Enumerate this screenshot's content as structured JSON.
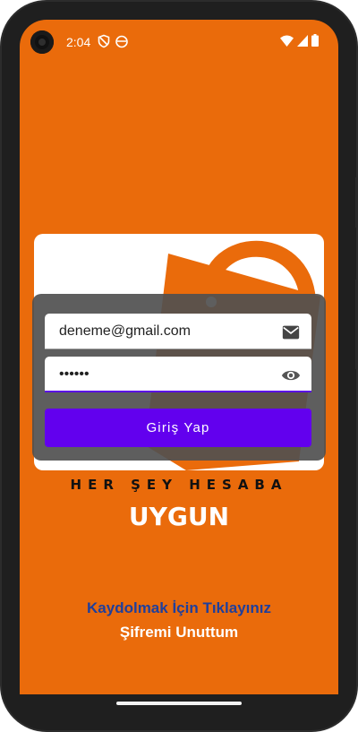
{
  "status_bar": {
    "time": "2:04",
    "left_icons": [
      "vpn-shield-icon",
      "cookie-icon"
    ],
    "right_icons": [
      "wifi-icon",
      "signal-icon",
      "battery-icon"
    ]
  },
  "logo": {
    "tagline": "HER ŞEY HESABA",
    "brand": "UYGUN",
    "bag_color": "#ea6b0b"
  },
  "login": {
    "email_value": "deneme@gmail.com",
    "email_icon": "mail-icon",
    "password_value": "••••••",
    "password_icon": "eye-icon",
    "button_label": "Giriş Yap",
    "button_color": "#6200ee"
  },
  "links": {
    "register": "Kaydolmak İçin Tıklayınız",
    "forgot_password": "Şifremi Unuttum"
  },
  "colors": {
    "background": "#ea6b0b",
    "link_blue": "#1f3f9c"
  }
}
